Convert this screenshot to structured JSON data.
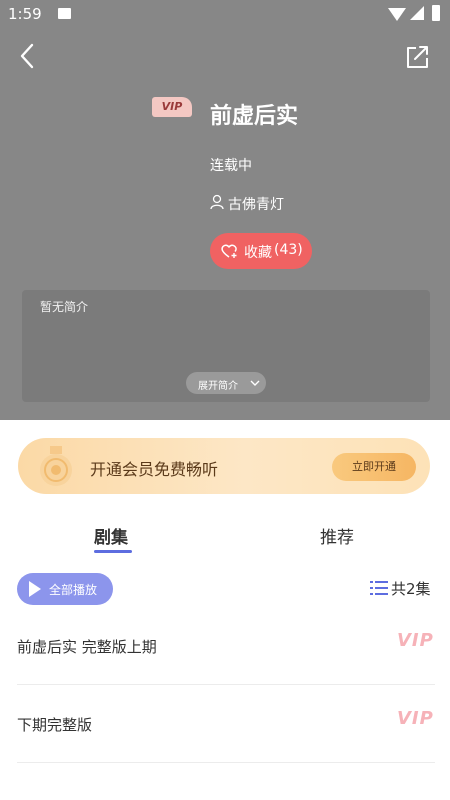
{
  "status_bar": {
    "time": "1:59"
  },
  "header": {
    "back_icon": "chevron-left-icon",
    "share_icon": "share-icon"
  },
  "book": {
    "badge": "VIP",
    "title": "前虚后实",
    "status": "连载中",
    "author": "古佛青灯",
    "favorite_label": "收藏",
    "favorite_count": "(43)",
    "intro": "暂无简介",
    "expand_label": "展开简介"
  },
  "banner": {
    "text": "开通会员免费畅听",
    "button": "立即开通"
  },
  "tabs": [
    {
      "label": "剧集",
      "active": true
    },
    {
      "label": "推荐",
      "active": false
    }
  ],
  "episodes": {
    "play_all": "全部播放",
    "count": "共2集",
    "items": [
      {
        "title": "前虚后实 完整版上期",
        "badge": "VIP"
      },
      {
        "title": "下期完整版",
        "badge": "VIP"
      }
    ]
  },
  "colors": {
    "accent": "#5d6de0",
    "favorite": "#f06262",
    "header_bg": "#878787"
  }
}
